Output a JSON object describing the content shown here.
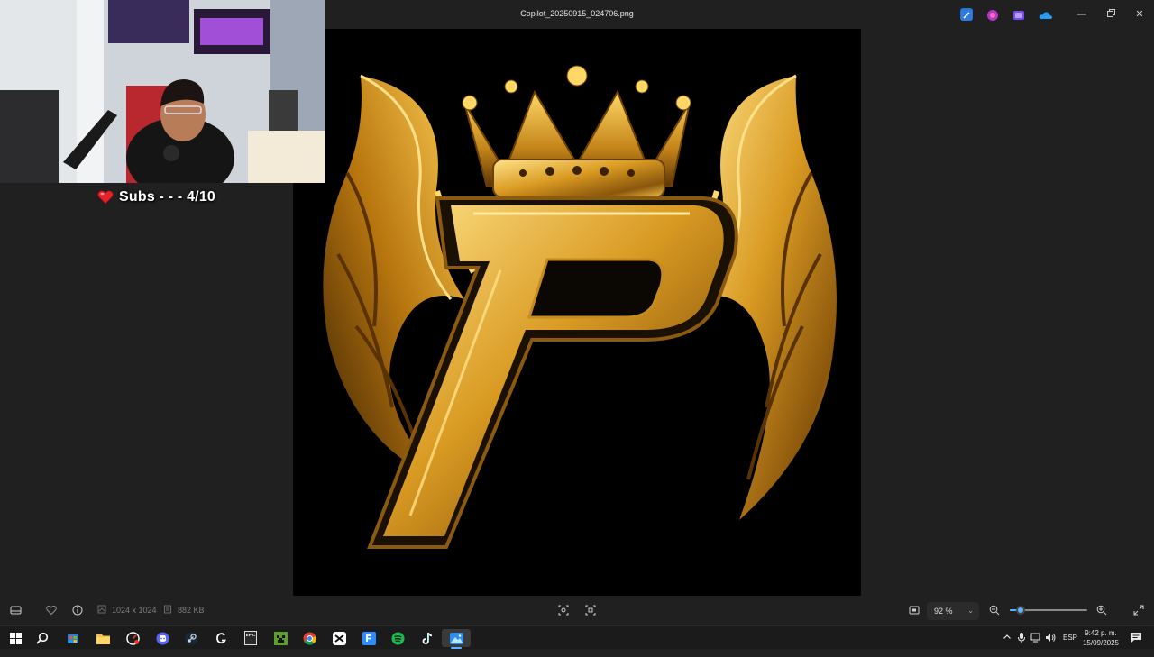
{
  "window": {
    "title": "Copilot_20250915_024706.png",
    "minimize_icon": "minimize-icon",
    "restore_icon": "restore-icon",
    "close_icon": "close-icon",
    "toolbar_apps": [
      "paint-icon",
      "clipchamp-icon",
      "designer-icon",
      "onedrive-icon"
    ]
  },
  "image": {
    "description_icon": "crowned-winged-P-logo",
    "colors": {
      "gold": "#d9a12a",
      "gold_light": "#ffd766",
      "gold_dark": "#6b4108",
      "background": "#000000"
    }
  },
  "overlay": {
    "subs_text": "Subs - - - 4/10",
    "heart_icon": "heart-icon",
    "heart_color": "#e3222b"
  },
  "bottombar": {
    "dimensions": "1024 x 1024",
    "file_size": "882 KB",
    "zoom_value": "92 %",
    "zoom_fraction": 0.14,
    "icons": [
      "filmstrip-icon",
      "favorite-icon",
      "info-icon",
      "dimensions-icon",
      "filesize-icon",
      "crop-icon",
      "visual-search-icon",
      "fit-icon",
      "zoom-out-icon",
      "zoom-in-icon",
      "fullscreen-icon"
    ]
  },
  "taskbar": {
    "apps": [
      "start-icon",
      "search-icon",
      "store-icon",
      "file-explorer-icon",
      "speedtest-icon",
      "discord-icon",
      "steam-icon",
      "gog-icon",
      "epic-games-icon",
      "minecraft-icon",
      "chrome-icon",
      "capcut-icon",
      "files-icon",
      "spotify-icon",
      "tiktok-icon",
      "photos-icon"
    ],
    "epic_label": "EPIC",
    "language": "ESP",
    "time": "9:42 p. m.",
    "date": "15/09/2025",
    "accent": "#5fb2ff"
  }
}
